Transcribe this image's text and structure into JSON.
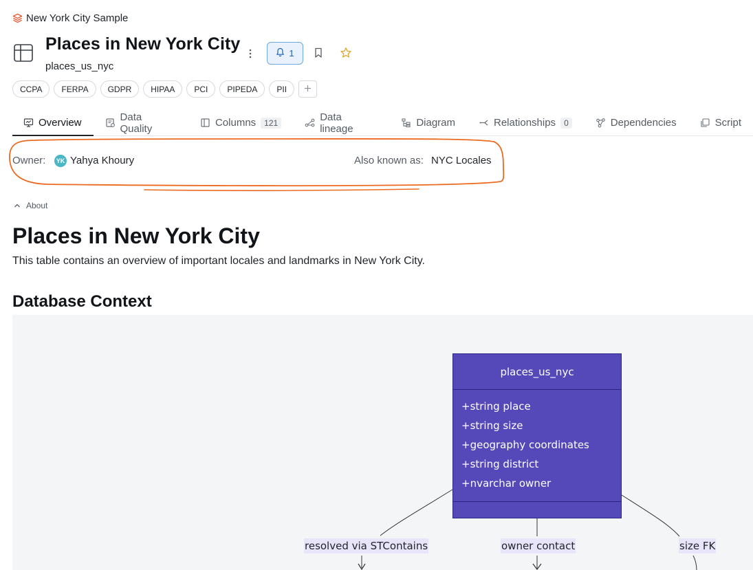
{
  "breadcrumb": {
    "label": "New York City Sample",
    "icon": "stack-icon",
    "icon_color": "#e8552d"
  },
  "header": {
    "title": "Places in New York City",
    "subtitle": "places_us_nyc",
    "alert_count": "1",
    "star_color": "#e0a82e"
  },
  "tags": [
    "CCPA",
    "FERPA",
    "GDPR",
    "HIPAA",
    "PCI",
    "PIPEDA",
    "PII"
  ],
  "tabs": [
    {
      "label": "Overview",
      "icon": "monitor-icon",
      "active": true
    },
    {
      "label": "Data Quality",
      "icon": "quality-icon"
    },
    {
      "label": "Columns",
      "icon": "columns-icon",
      "count": "121"
    },
    {
      "label": "Data lineage",
      "icon": "lineage-icon"
    },
    {
      "label": "Diagram",
      "icon": "diagram-icon"
    },
    {
      "label": "Relationships",
      "icon": "relationship-icon",
      "count": "0"
    },
    {
      "label": "Dependencies",
      "icon": "dependencies-icon"
    },
    {
      "label": "Script",
      "icon": "script-icon"
    }
  ],
  "owner": {
    "label": "Owner:",
    "initials": "YK",
    "name": "Yahya Khoury"
  },
  "aka": {
    "label": "Also known as:",
    "value": "NYC Locales"
  },
  "annotation_color": "#ec6a1f",
  "about": {
    "toggle_label": "About",
    "heading": "Places in New York City",
    "description": "This table contains an overview of important locales and landmarks in New York City.",
    "section_heading": "Database Context"
  },
  "diagram": {
    "entity_name": "places_us_nyc",
    "attributes": [
      "+string place",
      "+string size",
      "+geography coordinates",
      "+string district",
      "+nvarchar owner"
    ],
    "edge_labels": [
      "resolved via STContains",
      "owner contact",
      "size FK"
    ],
    "entity_color": "#5549b9"
  }
}
